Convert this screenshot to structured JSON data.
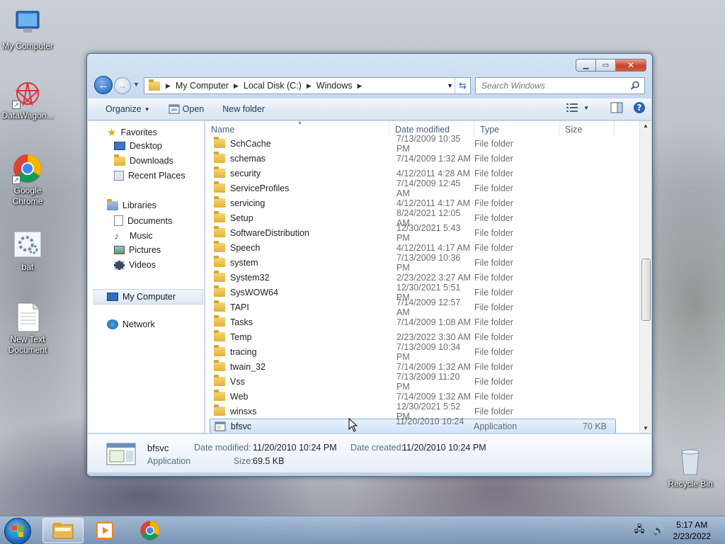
{
  "desktop": {
    "icons": [
      {
        "label": "My Computer"
      },
      {
        "label": "DataWagon..."
      },
      {
        "label": "Google Chrome"
      },
      {
        "label": "bat"
      },
      {
        "label": "New Text Document"
      },
      {
        "label": "Recycle Bin"
      }
    ]
  },
  "window": {
    "breadcrumb": [
      "My Computer",
      "Local Disk (C:)",
      "Windows"
    ],
    "search_placeholder": "Search Windows",
    "toolbar": {
      "organize": "Organize",
      "open": "Open",
      "new_folder": "New folder"
    },
    "nav": {
      "favorites": "Favorites",
      "favorites_items": [
        "Desktop",
        "Downloads",
        "Recent Places"
      ],
      "libraries": "Libraries",
      "libraries_items": [
        "Documents",
        "Music",
        "Pictures",
        "Videos"
      ],
      "my_computer": "My Computer",
      "network": "Network"
    },
    "columns": {
      "name": "Name",
      "date": "Date modified",
      "type": "Type",
      "size": "Size"
    },
    "files": [
      {
        "name": "SchCache",
        "date": "7/13/2009 10:35 PM",
        "type": "File folder",
        "size": ""
      },
      {
        "name": "schemas",
        "date": "7/14/2009 1:32 AM",
        "type": "File folder",
        "size": ""
      },
      {
        "name": "security",
        "date": "4/12/2011 4:28 AM",
        "type": "File folder",
        "size": ""
      },
      {
        "name": "ServiceProfiles",
        "date": "7/14/2009 12:45 AM",
        "type": "File folder",
        "size": ""
      },
      {
        "name": "servicing",
        "date": "4/12/2011 4:17 AM",
        "type": "File folder",
        "size": ""
      },
      {
        "name": "Setup",
        "date": "8/24/2021 12:05 AM",
        "type": "File folder",
        "size": ""
      },
      {
        "name": "SoftwareDistribution",
        "date": "12/30/2021 5:43 PM",
        "type": "File folder",
        "size": ""
      },
      {
        "name": "Speech",
        "date": "4/12/2011 4:17 AM",
        "type": "File folder",
        "size": ""
      },
      {
        "name": "system",
        "date": "7/13/2009 10:36 PM",
        "type": "File folder",
        "size": ""
      },
      {
        "name": "System32",
        "date": "2/23/2022 3:27 AM",
        "type": "File folder",
        "size": ""
      },
      {
        "name": "SysWOW64",
        "date": "12/30/2021 5:51 PM",
        "type": "File folder",
        "size": ""
      },
      {
        "name": "TAPI",
        "date": "7/14/2009 12:57 AM",
        "type": "File folder",
        "size": ""
      },
      {
        "name": "Tasks",
        "date": "7/14/2009 1:08 AM",
        "type": "File folder",
        "size": ""
      },
      {
        "name": "Temp",
        "date": "2/23/2022 3:30 AM",
        "type": "File folder",
        "size": ""
      },
      {
        "name": "tracing",
        "date": "7/13/2009 10:34 PM",
        "type": "File folder",
        "size": ""
      },
      {
        "name": "twain_32",
        "date": "7/14/2009 1:32 AM",
        "type": "File folder",
        "size": ""
      },
      {
        "name": "Vss",
        "date": "7/13/2009 11:20 PM",
        "type": "File folder",
        "size": ""
      },
      {
        "name": "Web",
        "date": "7/14/2009 1:32 AM",
        "type": "File folder",
        "size": ""
      },
      {
        "name": "winsxs",
        "date": "12/30/2021 5:52 PM",
        "type": "File folder",
        "size": ""
      },
      {
        "name": "bfsvc",
        "date": "11/20/2010 10:24 ...",
        "type": "Application",
        "size": "70 KB",
        "selected": true
      }
    ],
    "details": {
      "name": "bfsvc",
      "type": "Application",
      "date_modified_label": "Date modified:",
      "date_modified": "11/20/2010 10:24 PM",
      "date_created_label": "Date created:",
      "date_created": "11/20/2010 10:24 PM",
      "size_label": "Size:",
      "size": "69.5 KB"
    }
  },
  "taskbar": {
    "time": "5:17 AM",
    "date": "2/23/2022"
  }
}
